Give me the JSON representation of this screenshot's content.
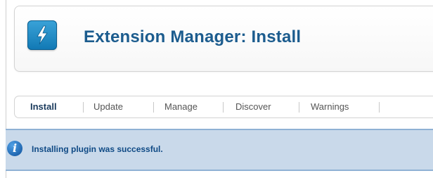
{
  "header": {
    "title": "Extension Manager: Install",
    "icon": "lightning-bolt-icon",
    "icon_color": "#1a86c4"
  },
  "tabs": [
    {
      "label": "Install",
      "active": true
    },
    {
      "label": "Update",
      "active": false
    },
    {
      "label": "Manage",
      "active": false
    },
    {
      "label": "Discover",
      "active": false
    },
    {
      "label": "Warnings",
      "active": false
    }
  ],
  "message": {
    "icon": "info-icon",
    "text": "Installing plugin was successful.",
    "background": "#c9d9ea"
  }
}
